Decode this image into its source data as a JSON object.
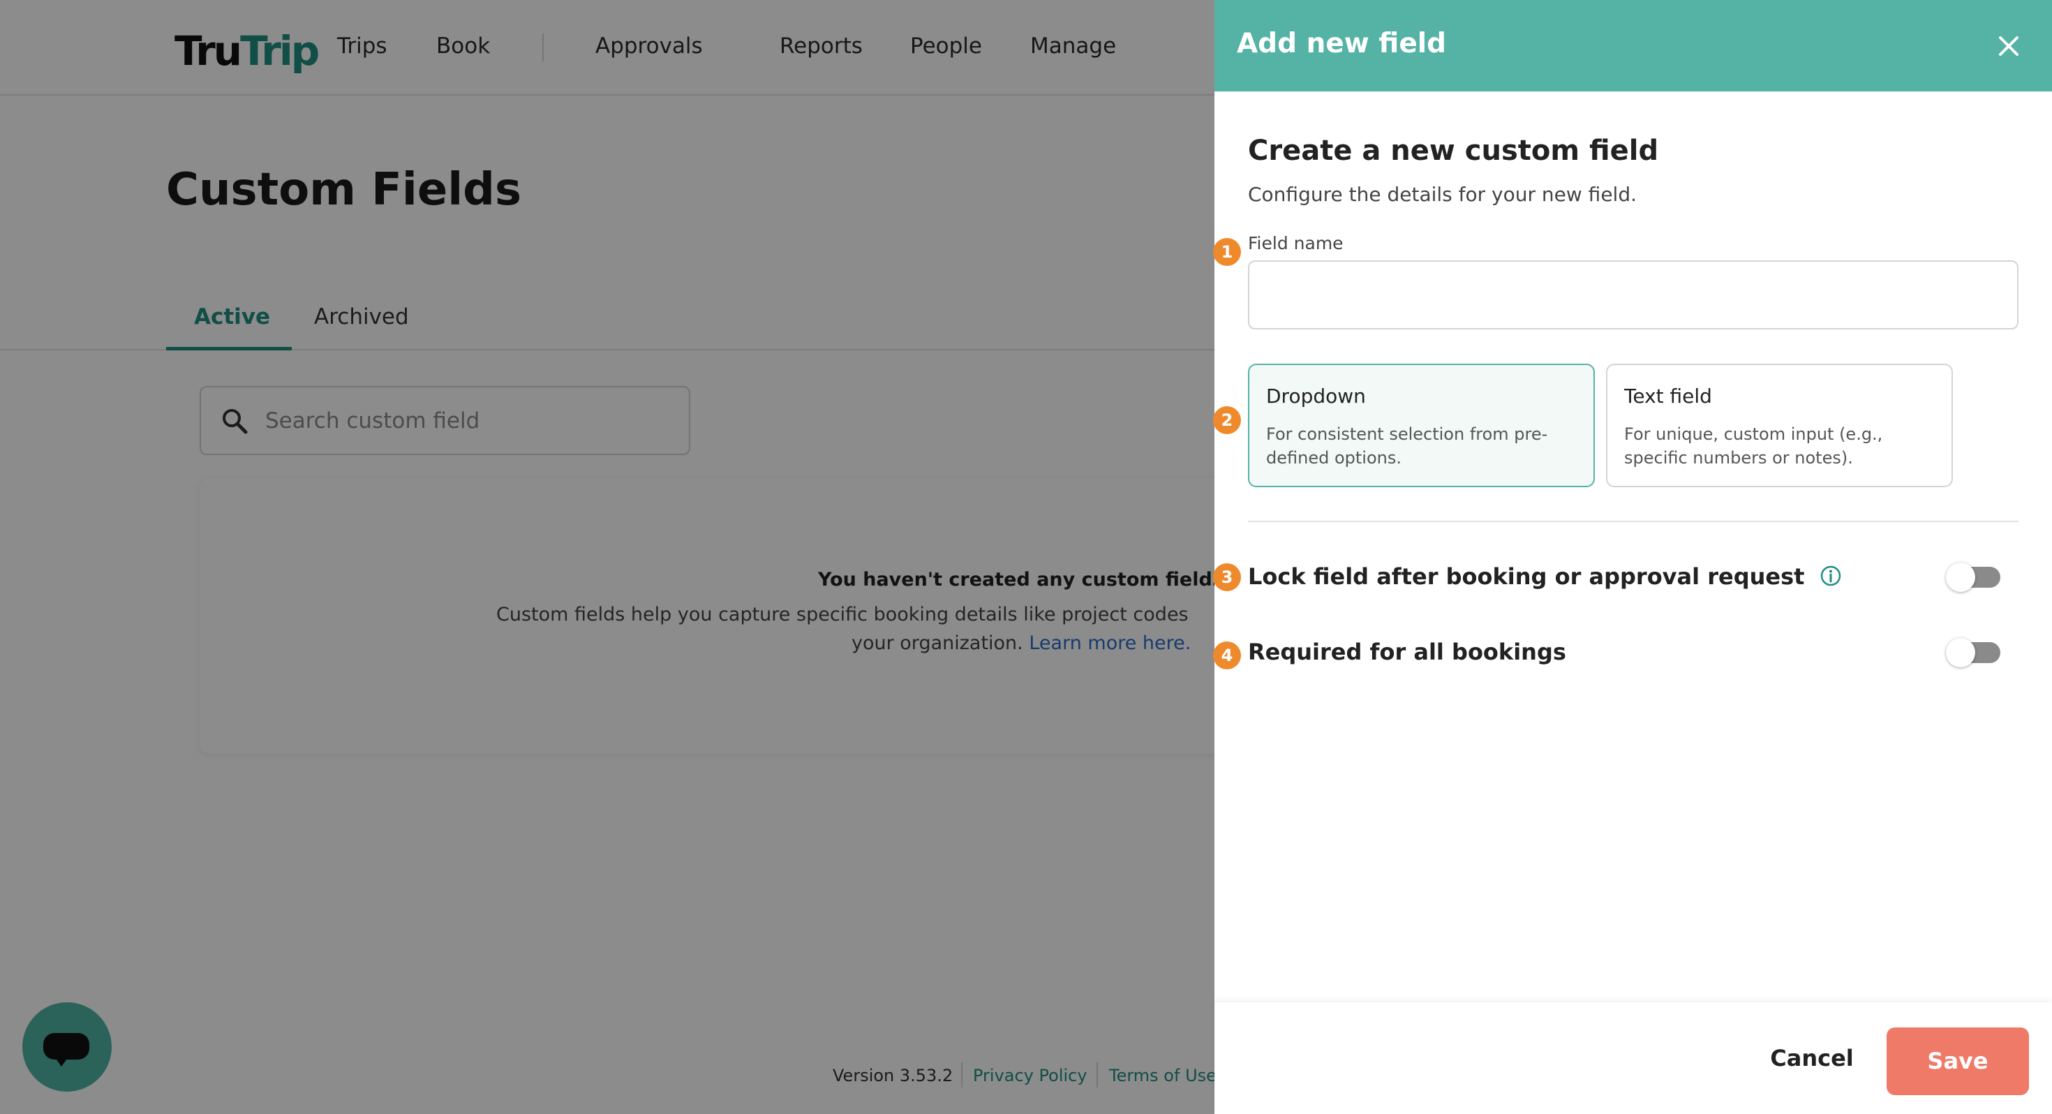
{
  "app": {
    "logo": {
      "part1": "Tru",
      "part2": "Trip"
    },
    "nav": [
      "Trips",
      "Book",
      "Approvals",
      "Reports",
      "People",
      "Manage"
    ],
    "page_title": "Custom Fields",
    "tabs": [
      {
        "label": "Active",
        "active": true
      },
      {
        "label": "Archived",
        "active": false
      }
    ],
    "search": {
      "placeholder": "Search custom field",
      "icon": "search-icon"
    },
    "empty_state": {
      "title": "You haven't created any custom fields ye",
      "desc_line1": "Custom fields help you capture specific booking details like project codes",
      "desc_line2": "your organization.",
      "link": "Learn more here."
    },
    "footer": {
      "version": "Version 3.53.2",
      "privacy": "Privacy Policy",
      "terms": "Terms of Use"
    },
    "chat_icon": "chat-bubble-icon"
  },
  "drawer": {
    "title": "Add new field",
    "close_icon": "close-icon",
    "heading": "Create a new custom field",
    "subheading": "Configure the details for your new field.",
    "field_name": {
      "marker": "1",
      "label": "Field name",
      "value": "",
      "placeholder": ""
    },
    "type_marker": "2",
    "types": [
      {
        "title": "Dropdown",
        "desc": "For consistent selection from pre-defined options.",
        "selected": true
      },
      {
        "title": "Text field",
        "desc": "For unique, custom input (e.g., specific numbers or notes).",
        "selected": false
      }
    ],
    "lock_toggle": {
      "marker": "3",
      "label": "Lock field after booking or approval request",
      "on": false
    },
    "required_toggle": {
      "marker": "4",
      "label": "Required for all bookings",
      "on": false
    },
    "cancel_label": "Cancel",
    "save_label": "Save"
  },
  "colors": {
    "brand_teal": "#54b3a4",
    "link_blue": "#2e6cc7",
    "save_coral": "#ef7a68",
    "marker_orange": "#ee8a2c"
  }
}
